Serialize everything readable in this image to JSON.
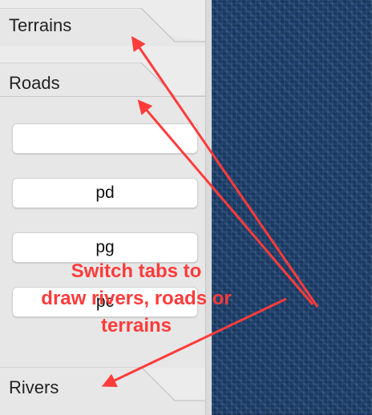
{
  "tabs": {
    "terrains_label": "Terrains",
    "roads_label": "Roads",
    "rivers_label": "Rivers"
  },
  "road_buttons": [
    {
      "label": ""
    },
    {
      "label": "pd"
    },
    {
      "label": "pg"
    },
    {
      "label": "pc"
    }
  ],
  "annotation": {
    "line1": "Switch tabs to",
    "line2": "draw rivers, roads or",
    "line3": "terrains",
    "color": "#ff3b3b"
  },
  "map_color": "#1d3f6b"
}
